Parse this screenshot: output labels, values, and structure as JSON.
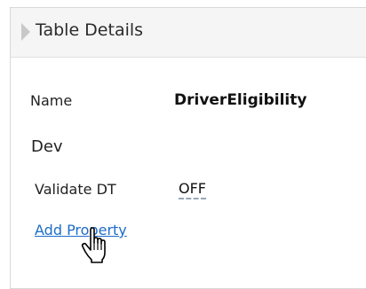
{
  "panel": {
    "title": "Table Details"
  },
  "properties": {
    "name_label": "Name",
    "name_value": "DriverEligibility",
    "group_label": "Dev",
    "validate_label": "Validate DT",
    "validate_value": "OFF",
    "add_property_label": "Add Property"
  },
  "icons": {
    "header_arrow": "collapse-arrow-icon",
    "cursor": "hand-pointer-cursor-icon"
  },
  "colors": {
    "link": "#1e6cc8",
    "header_bg": "#f5f5f5"
  }
}
